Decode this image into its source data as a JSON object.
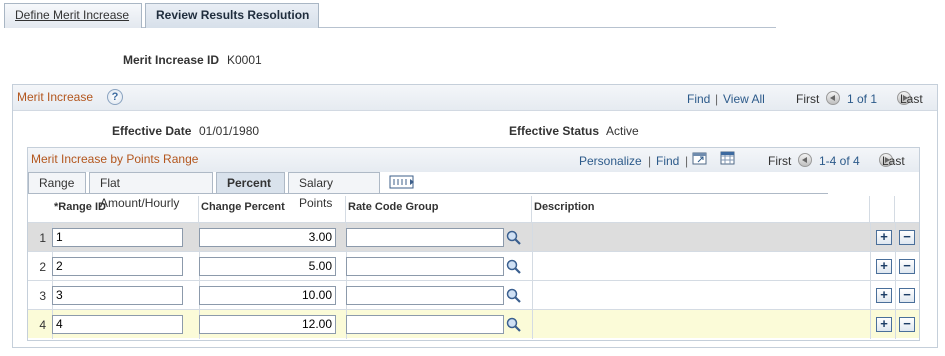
{
  "top_tabs": [
    {
      "label": "Define Merit Increase",
      "active": false
    },
    {
      "label": "Review Results Resolution",
      "active": true
    }
  ],
  "header": {
    "merit_id_label": "Merit Increase ID",
    "merit_id_value": "K0001"
  },
  "group": {
    "title": "Merit Increase",
    "help_glyph": "?",
    "find": "Find",
    "sep": "|",
    "view_all": "View All",
    "first": "First",
    "count": "1 of 1",
    "last": "Last",
    "effective_date_label": "Effective Date",
    "effective_date_value": "01/01/1980",
    "effective_status_label": "Effective Status",
    "effective_status_value": "Active"
  },
  "grid": {
    "title": "Merit Increase by Points Range",
    "personalize": "Personalize",
    "find": "Find",
    "sep": "|",
    "first": "First",
    "count": "1-4 of 4",
    "last": "Last",
    "tabs": [
      {
        "label": "Range",
        "active": false
      },
      {
        "label": "Flat Amount/Hourly",
        "active": false
      },
      {
        "label": "Percent",
        "active": true
      },
      {
        "label": "Salary Points",
        "active": false
      }
    ],
    "columns": [
      "*Range ID",
      "Change Percent",
      "Rate Code Group",
      "Description"
    ],
    "rows": [
      {
        "num": "1",
        "range_id": "1",
        "change_percent": "3.00",
        "rate_code_group": "",
        "description": ""
      },
      {
        "num": "2",
        "range_id": "2",
        "change_percent": "5.00",
        "rate_code_group": "",
        "description": ""
      },
      {
        "num": "3",
        "range_id": "3",
        "change_percent": "10.00",
        "rate_code_group": "",
        "description": ""
      },
      {
        "num": "4",
        "range_id": "4",
        "change_percent": "12.00",
        "rate_code_group": "",
        "description": ""
      }
    ],
    "add_glyph": "+",
    "delete_glyph": "−"
  },
  "colors": {
    "link": "#2c5a8a",
    "group_title": "#b3561d",
    "selected_row": "#dddddd",
    "highlight_row": "#fbfbd8"
  }
}
